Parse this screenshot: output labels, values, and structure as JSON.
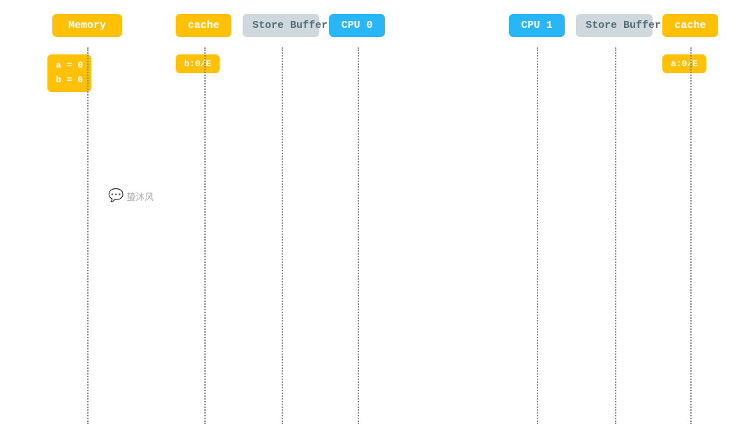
{
  "memory": {
    "header": "Memory",
    "content_line1": "a = 0",
    "content_line2": "b = 0"
  },
  "cpu0": {
    "cache_label": "cache",
    "storebuffer_label": "Store Buffer",
    "cpu_label": "CPU 0",
    "cache_content": "b:0/E"
  },
  "cpu1": {
    "cpu_label": "CPU 1",
    "storebuffer_label": "Store Buffer",
    "cache_label": "cache",
    "cache_content": "a:0/E"
  },
  "watermark": {
    "icon": "💬",
    "text": "蛰沐风"
  },
  "colors": {
    "yellow": "#FFC107",
    "blue": "#29B6F6",
    "gray": "#CFD8DC",
    "dotted": "#888888"
  }
}
